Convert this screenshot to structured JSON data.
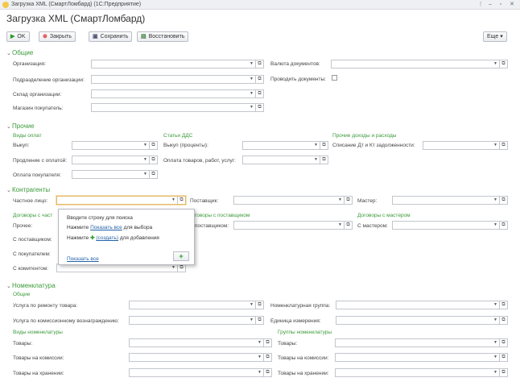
{
  "window": {
    "title": "Загрузка XML (СмартЛомбард) (1С:Предприятие)",
    "controls": [
      "⋮",
      "–",
      "▫",
      "✕"
    ]
  },
  "page_title": "Загрузка XML (СмартЛомбард)",
  "toolbar": {
    "ok": "OK",
    "close": "Закрыть",
    "save": "Сохранить",
    "restore": "Восстановить",
    "more": "Еще"
  },
  "sections": {
    "general": {
      "title": "Общие",
      "organization": "Организация:",
      "subdivision": "Подразделение организации:",
      "warehouse": "Склад организации:",
      "buyer_store": "Магазин покупатель:",
      "currency": "Валюта документов:",
      "post_docs": "Проводить документы:"
    },
    "other": {
      "title": "Прочие",
      "payment_types": "Виды оплат",
      "buyout": "Выкуп:",
      "extension": "Продление с оплатой:",
      "buyer_payment": "Оплата покупателя:",
      "dds_title": "Статьи ДДС",
      "buyout_percent": "Выкуп (проценты):",
      "goods_payment": "Оплата товаров, работ, услуг:",
      "income_title": "Прочие доходы и расходы",
      "writeoff": "Списание Дт и Кт задолженности:"
    },
    "counterparties": {
      "title": "Контрагенты",
      "person": "Частное лицо:",
      "supplier": "Поставщик:",
      "master": "Мастер:",
      "contracts_person": "Договоры с част",
      "other": "Прочее:",
      "with_supplier": "С поставщиком:",
      "with_buyer": "С покупателем:",
      "with_commission": "С комитентом:",
      "contracts_supplier": "говоры с поставщиком",
      "with_supplier2": "поставщиком:",
      "contracts_master": "Договоры с мастером",
      "with_master": "С мастером:"
    },
    "nomenclature": {
      "title": "Номенклатура",
      "general": "Общие",
      "repair": "Услуга по ремонту товара:",
      "commission_fee": "Услуга по комиссионному вознаграждению:",
      "group": "Номенклатурная группа:",
      "unit": "Единица измерения:",
      "kinds": "Виды номенклатуры",
      "goods": "Товары:",
      "goods_commission": "Товары на комиссии:",
      "goods_storage": "Товары на хранении:",
      "groups": "Группы номенклатуры",
      "goods2": "Товары:",
      "goods_commission2": "Товары на комиссии:",
      "goods_storage2": "Товары на хранении:"
    }
  },
  "popup": {
    "hint": "Вводите строку для поиска",
    "line1_a": "Нажмите",
    "line1_link": "Показать все",
    "line1_b": "для выбора",
    "line2_a": "Нажмите",
    "line2_link": "(создать)",
    "line2_b": "для добавления",
    "show_all": "Показать все"
  }
}
